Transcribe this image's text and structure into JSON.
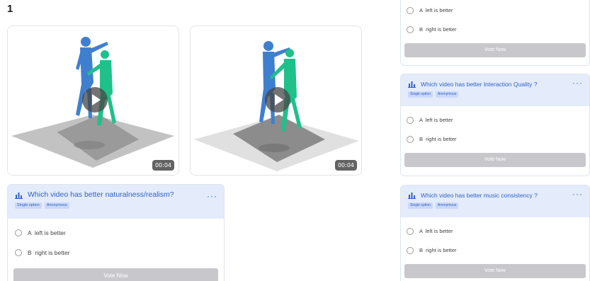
{
  "section": {
    "number": "1"
  },
  "videos": [
    {
      "duration": "00:04"
    },
    {
      "duration": "00:04"
    }
  ],
  "polls": {
    "main": {
      "title": "Which video has better naturalness/realism?",
      "tags": [
        "Single option",
        "Anonymous"
      ],
      "options": [
        "A  left is better",
        "B  right is better"
      ],
      "vote_label": "Vote Now",
      "more": "···"
    },
    "top": {
      "options": [
        "A  left is better",
        "B  right is better"
      ],
      "vote_label": "Vote Now"
    },
    "interaction": {
      "title": "Which video has better Interaction Quality ?",
      "tags": [
        "Single option",
        "Anonymous"
      ],
      "options": [
        "A  left is better",
        "B  right is better"
      ],
      "vote_label": "Vote Now",
      "more": "···"
    },
    "music": {
      "title": "Which video has better music consistency ?",
      "tags": [
        "Single option",
        "Anonymous"
      ],
      "options": [
        "A  left is better",
        "B  right is better"
      ],
      "vote_label": "Vote Now",
      "more": "···"
    }
  },
  "colors": {
    "accent": "#2f63c8",
    "poll_header_bg": "#e4ebfb",
    "vote_button": "#c8c8cc",
    "figure_blue": "#3f7fd0",
    "figure_green": "#1fc08a"
  },
  "icons": {
    "poll": "bar-chart-icon",
    "play": "play-icon",
    "radio": "radio-circle-icon",
    "more": "more-dots-icon"
  }
}
